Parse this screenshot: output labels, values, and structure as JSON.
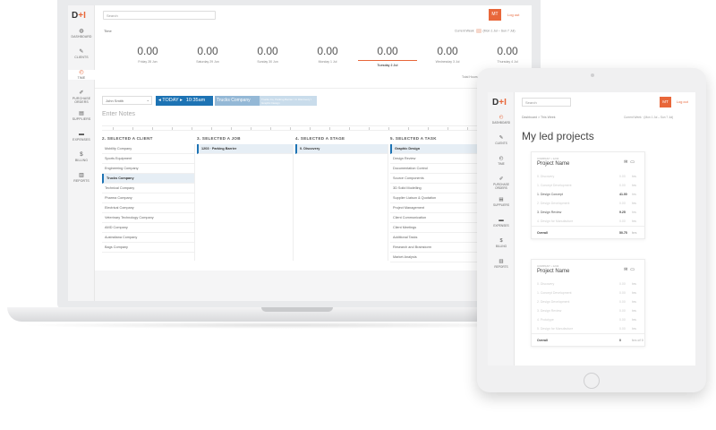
{
  "laptop": {
    "logo": {
      "text": "D",
      "plus": "+I"
    },
    "search_placeholder": "Search",
    "avatar": "MT",
    "logout": "Log out",
    "nav": [
      {
        "icon": "dashboard-icon",
        "glyph": "◍",
        "label": "DASHBOARD"
      },
      {
        "icon": "clients-icon",
        "glyph": "✎",
        "label": "CLIENTS"
      },
      {
        "icon": "time-icon",
        "glyph": "◴",
        "label": "TIME",
        "active": true
      },
      {
        "icon": "purchase-orders-icon",
        "glyph": "✐",
        "label": "PURCHASE ORDERS"
      },
      {
        "icon": "suppliers-icon",
        "glyph": "▤",
        "label": "SUPPLIERS"
      },
      {
        "icon": "expenses-icon",
        "glyph": "▬",
        "label": "EXPENSES"
      },
      {
        "icon": "billing-icon",
        "glyph": "$",
        "label": "BILLING"
      },
      {
        "icon": "reports-icon",
        "glyph": "▥",
        "label": "REPORTS"
      }
    ],
    "time_label": "Time",
    "period": {
      "label": "Current Week",
      "range": "(Mon 1 Jul – Sun 7 Jul)"
    },
    "days": [
      {
        "value": "0.00",
        "label": "Friday 28 Jun"
      },
      {
        "value": "0.00",
        "label": "Saturday 29 Jun"
      },
      {
        "value": "0.00",
        "label": "Sunday 30 Jun"
      },
      {
        "value": "0.00",
        "label": "Monday 1 Jul"
      },
      {
        "value": "0.00",
        "label": "Tuesday 2 Jul",
        "today": true
      },
      {
        "value": "0.00",
        "label": "Wednesday 3 Jul"
      },
      {
        "value": "0.00",
        "label": "Thursday 4 Jul"
      }
    ],
    "total_label": "Total Hours",
    "user": "John Smith",
    "today_label": "TODAY",
    "clock": "10:35am",
    "chip": "Trucks Company",
    "chip_detail": "Trucks Co, Parking Barrier / 0. Discovery / Graphic Design",
    "notes_placeholder": "Enter Notes",
    "columns": [
      {
        "title": "2. SELECTED A CLIENT",
        "rows": [
          "Mobility Company",
          "Sports Equipment",
          "Engineering Company",
          "Trucks Company",
          "Technical Company",
          "Pharma Company",
          "Electrical Company",
          "Veterinary Technology Company",
          "AMD Company",
          "Australiana Company",
          "Bags Company"
        ],
        "selected": 3
      },
      {
        "title": "3. SELECTED A JOB",
        "rows": [
          "1203 · Parking Barrier"
        ],
        "selected": 0
      },
      {
        "title": "4. SELECTED A STAGE",
        "rows": [
          "0. Discovery"
        ],
        "selected": 0
      },
      {
        "title": "5. SELECTED A TASK",
        "rows": [
          "Graphic Design",
          "Design Review",
          "Documentation Control",
          "Source Components",
          "3D Solid Modelling",
          "Supplier Liaison & Quotation",
          "Project Management",
          "Client Communication",
          "Client Meetings",
          "Additional Tasks",
          "Research and Brainstorm",
          "Market Analysis"
        ],
        "selected": 0
      }
    ]
  },
  "tablet": {
    "logo": {
      "text": "D",
      "plus": "+I"
    },
    "search_placeholder": "Search",
    "avatar": "MT",
    "logout": "Log out",
    "breadcrumb": "Dashboard  >  This Week",
    "period": "Current Week · (Mon 1 Jul – Sun 7 Jul)",
    "nav": [
      {
        "icon": "dashboard-icon",
        "glyph": "◴",
        "label": "DASHBOARD",
        "active": true
      },
      {
        "icon": "clients-icon",
        "glyph": "✎",
        "label": "CLIENTS"
      },
      {
        "icon": "time-icon",
        "glyph": "◴",
        "label": "TIME"
      },
      {
        "icon": "purchase-orders-icon",
        "glyph": "✐",
        "label": "PURCHASE ORDERS"
      },
      {
        "icon": "suppliers-icon",
        "glyph": "▤",
        "label": "SUPPLIERS"
      },
      {
        "icon": "expenses-icon",
        "glyph": "▬",
        "label": "EXPENSES"
      },
      {
        "icon": "billing-icon",
        "glyph": "$",
        "label": "BILLING"
      },
      {
        "icon": "reports-icon",
        "glyph": "▥",
        "label": "REPORTS"
      }
    ],
    "title": "My led projects",
    "cards": [
      {
        "meta": "COMPANY • 1234",
        "name": "Project Name",
        "lines": [
          {
            "label": "0. Discovery",
            "value": "0.00",
            "unit": "hrs",
            "style": "faint"
          },
          {
            "label": "1. Concept Development",
            "value": "0.00",
            "unit": "hrs",
            "style": "faint"
          },
          {
            "label": "1. Design Concept",
            "value": "41.00",
            "unit": "hrs",
            "style": "strong"
          },
          {
            "label": "2. Design Development",
            "value": "0.00",
            "unit": "hrs",
            "style": "faint"
          },
          {
            "label": "3. Design Review",
            "value": "9.25",
            "unit": "hrs",
            "style": "strong"
          },
          {
            "label": "4. Design for Manufacture",
            "value": "0.00",
            "unit": "hrs",
            "style": "faint"
          }
        ],
        "overall": {
          "label": "Overall",
          "value": "50.75",
          "unit": "hrs"
        }
      },
      {
        "meta": "COMPANY • 1234",
        "name": "Project Name",
        "lines": [
          {
            "label": "0. Discovery",
            "value": "0.00",
            "unit": "hrs",
            "style": "faint"
          },
          {
            "label": "1. Concept Development",
            "value": "0.00",
            "unit": "hrs",
            "style": "faint"
          },
          {
            "label": "2. Design Development",
            "value": "0.00",
            "unit": "hrs",
            "style": "faint"
          },
          {
            "label": "3. Design Review",
            "value": "0.00",
            "unit": "hrs",
            "style": "faint"
          },
          {
            "label": "4. Prototype",
            "value": "0.00",
            "unit": "hrs",
            "style": "faint"
          },
          {
            "label": "5. Design for Manufacture",
            "value": "0.00",
            "unit": "hrs",
            "style": "faint"
          }
        ],
        "overall": {
          "label": "Overall",
          "value": "0",
          "unit": "hrs of 0"
        }
      }
    ]
  }
}
